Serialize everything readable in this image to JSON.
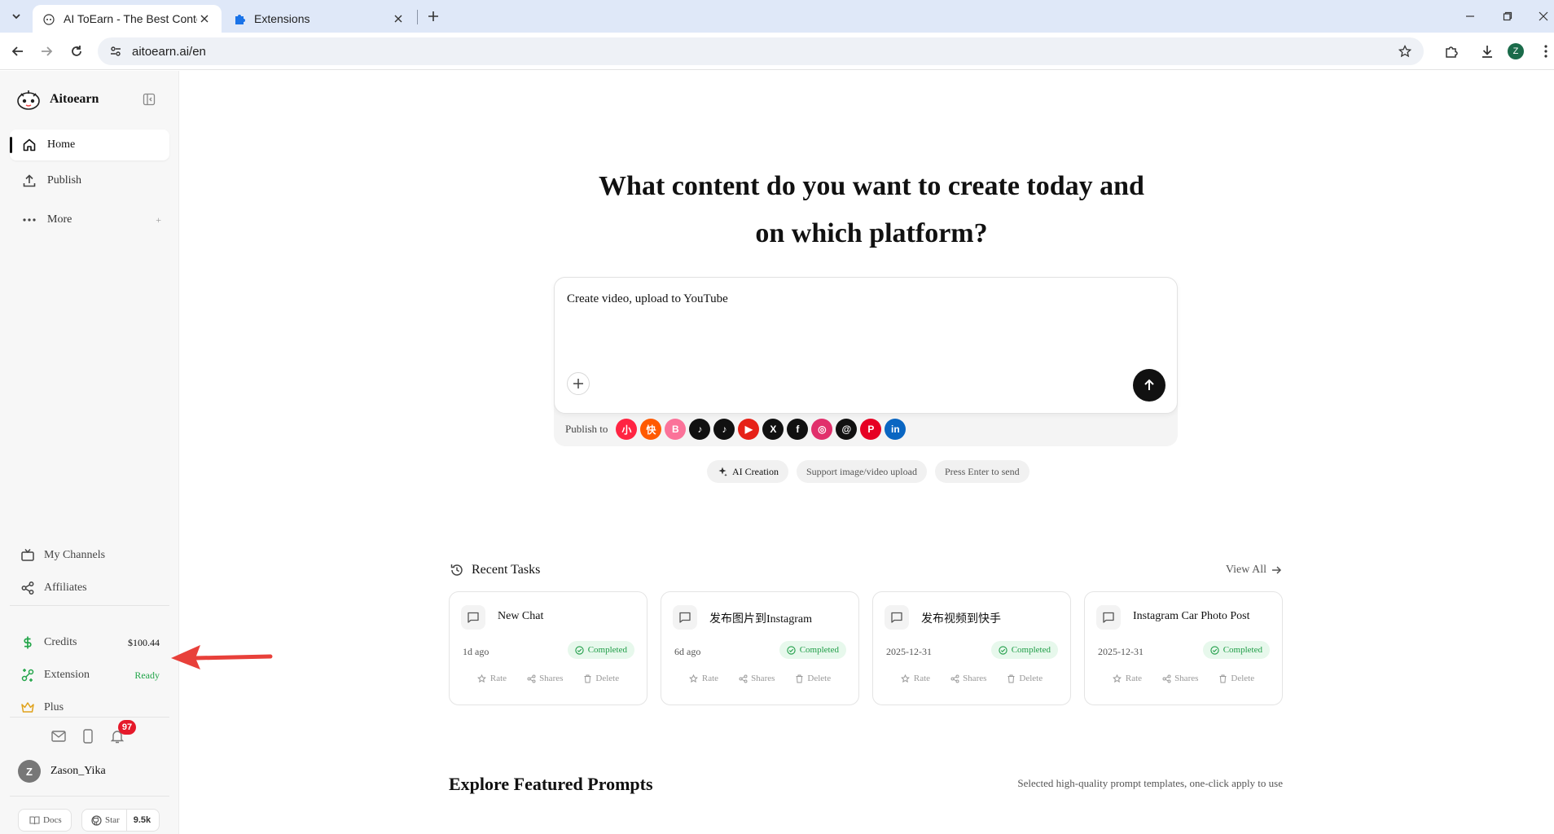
{
  "browser": {
    "tabs": [
      {
        "title": "AI ToEarn - The Best Content",
        "active": true
      },
      {
        "title": "Extensions",
        "active": false
      }
    ],
    "url": "aitoearn.ai/en",
    "profile_initial": "Z"
  },
  "sidebar": {
    "brand": "Aitoearn",
    "nav": [
      {
        "label": "Home",
        "icon": "home-icon",
        "active": true
      },
      {
        "label": "Publish",
        "icon": "upload-icon",
        "active": false
      },
      {
        "label": "More",
        "icon": "more-dots-icon",
        "active": false,
        "suffix": "+"
      }
    ],
    "lower": [
      {
        "label": "My Channels",
        "icon": "tv-icon"
      },
      {
        "label": "Affiliates",
        "icon": "share-nodes-icon"
      }
    ],
    "account": [
      {
        "label": "Credits",
        "icon": "dollar-icon",
        "value": "$100.44"
      },
      {
        "label": "Extension",
        "icon": "extension-icon",
        "value": "Ready"
      },
      {
        "label": "Plus",
        "icon": "crown-icon",
        "value": ""
      }
    ],
    "notification_count": "97",
    "user": {
      "initial": "Z",
      "name": "Zason_Yika"
    },
    "footer": {
      "docs_label": "Docs",
      "star_label": "Star",
      "star_count": "9.5k"
    }
  },
  "main": {
    "headline_line1": "What content do you want to create today and",
    "headline_line2": "on which platform?",
    "composer": {
      "prompt": "Create video, upload to YouTube"
    },
    "publish_to_label": "Publish to",
    "platforms": [
      {
        "name": "xiaohongshu",
        "color": "#ff2442",
        "glyph": "小"
      },
      {
        "name": "kuaishou",
        "color": "#ff5a00",
        "glyph": "快"
      },
      {
        "name": "bilibili",
        "color": "#fb7299",
        "glyph": "B"
      },
      {
        "name": "tiktok",
        "color": "#111111",
        "glyph": "♪"
      },
      {
        "name": "douyin",
        "color": "#111111",
        "glyph": "♪"
      },
      {
        "name": "youtube",
        "color": "#e62117",
        "glyph": "▶"
      },
      {
        "name": "x",
        "color": "#111111",
        "glyph": "X"
      },
      {
        "name": "facebook",
        "color": "#111111",
        "glyph": "f"
      },
      {
        "name": "instagram",
        "color": "#e1306c",
        "glyph": "◎"
      },
      {
        "name": "threads",
        "color": "#111111",
        "glyph": "@"
      },
      {
        "name": "pinterest",
        "color": "#e60023",
        "glyph": "P"
      },
      {
        "name": "linkedin",
        "color": "#0a66c2",
        "glyph": "in"
      }
    ],
    "chips": [
      "AI Creation",
      "Support image/video upload",
      "Press Enter to send"
    ],
    "recent": {
      "title": "Recent Tasks",
      "view_all": "View All",
      "tasks": [
        {
          "title": "New Chat",
          "date": "1d ago",
          "status": "Completed"
        },
        {
          "title": "发布图片到Instagram",
          "date": "6d ago",
          "status": "Completed"
        },
        {
          "title": "发布视频到快手",
          "date": "2025-12-31",
          "status": "Completed"
        },
        {
          "title": "Instagram Car Photo Post",
          "date": "2025-12-31",
          "status": "Completed"
        }
      ],
      "actions": [
        "Rate",
        "Shares",
        "Delete"
      ]
    },
    "explore": {
      "title": "Explore Featured Prompts",
      "subtitle": "Selected high-quality prompt templates, one-click apply to use"
    }
  },
  "colors": {
    "accent": "#111111",
    "success": "#23a54a",
    "badge": "#e5192a",
    "annotation_arrow": "#e8403a"
  }
}
